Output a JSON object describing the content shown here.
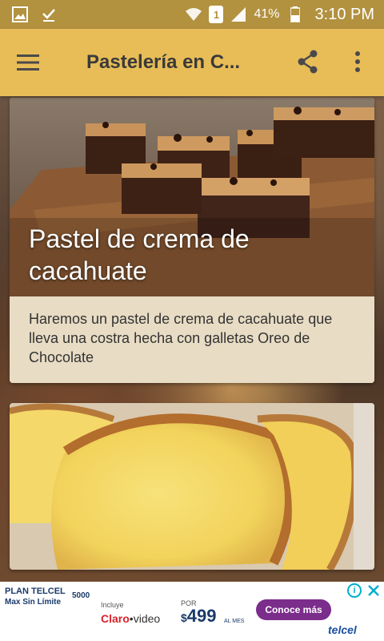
{
  "status_bar": {
    "battery_percent": "41%",
    "time": "3:10 PM",
    "sim_slot": "1",
    "icons": [
      "gallery-icon",
      "download-done-icon",
      "wifi-icon",
      "sim-icon",
      "signal-icon",
      "battery-icon"
    ]
  },
  "app_bar": {
    "title": "Pastelería en C...",
    "menu_icon": "hamburger-menu-icon",
    "share_icon": "share-icon",
    "more_icon": "more-vert-icon"
  },
  "recipes": [
    {
      "title": "Pastel de crema de cacahuate",
      "description": "Haremos un pastel de crema de cacahuate que lleva una costra hecha con galletas Oreo de Chocolate"
    },
    {
      "title": "",
      "description": ""
    }
  ],
  "ad": {
    "plan_line1": "PLAN TELCEL",
    "plan_line2": "Max Sin Límite",
    "plan_number": "5000",
    "includes": "Incluye",
    "claro_text": "Claro",
    "video_text": "video",
    "por": "POR",
    "currency": "$",
    "price": "499",
    "period": "AL MES",
    "cta": "Conoce más",
    "brand": "telcel"
  },
  "colors": {
    "status_bar": "#b2913f",
    "app_bar": "#e8bd57",
    "card_desc_bg": "#e8dcc4"
  }
}
